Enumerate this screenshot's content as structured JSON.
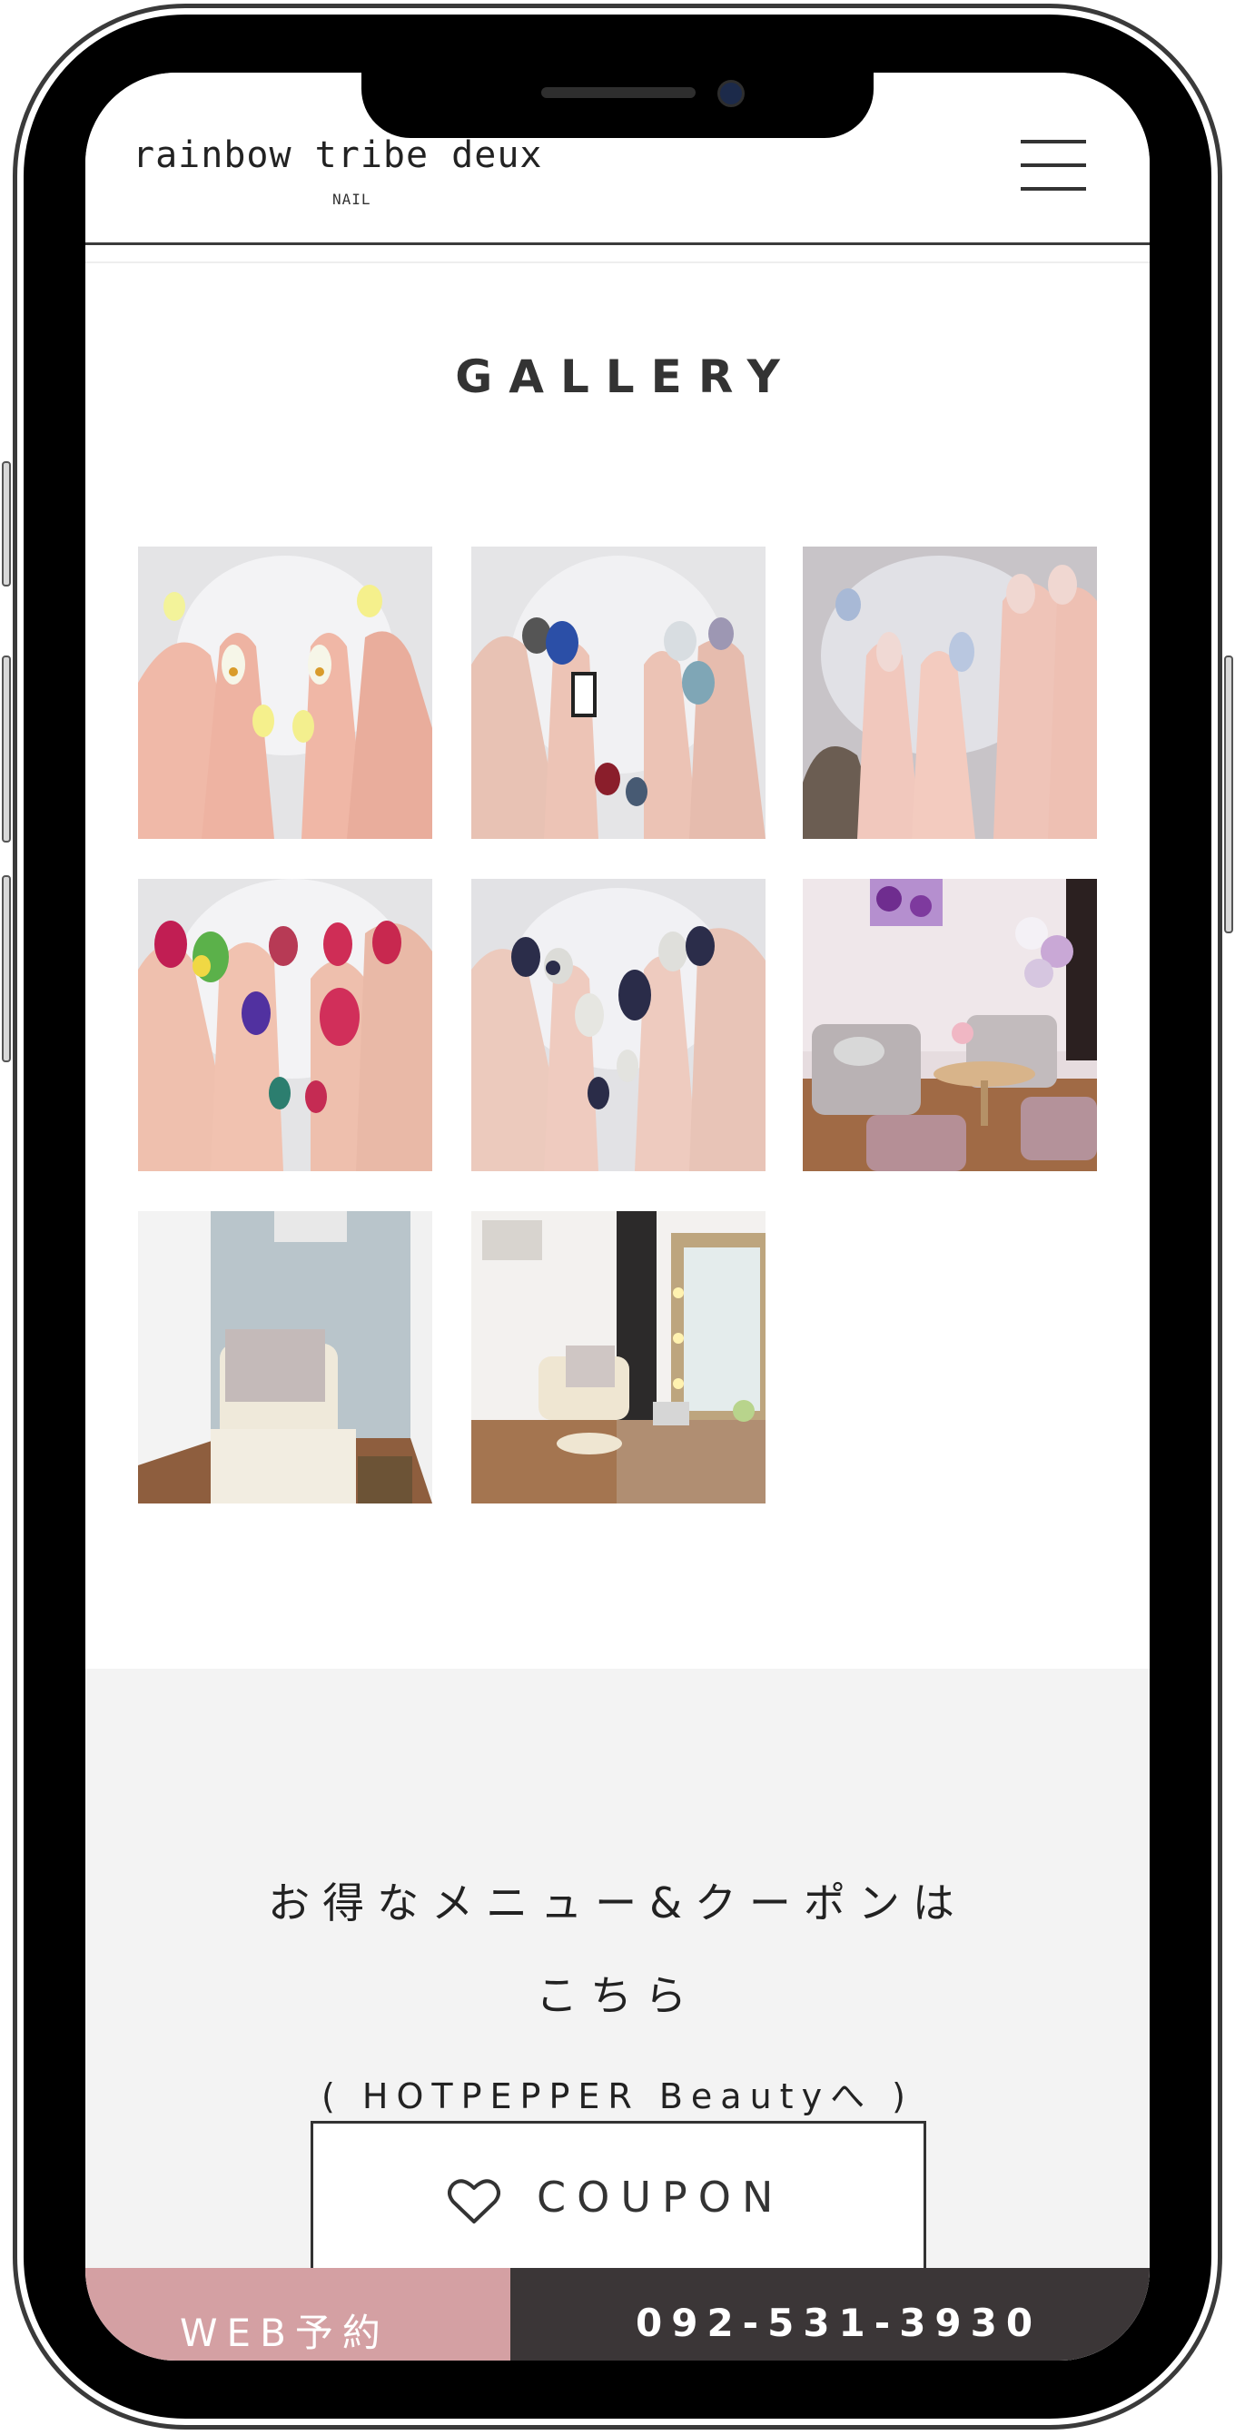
{
  "header": {
    "logo": "rainbow tribe deux",
    "logo_sub": "NAIL",
    "menu_icon": "hamburger-menu-icon"
  },
  "gallery": {
    "title": "GALLERY",
    "images": [
      {
        "name": "gallery-photo-yellow-nails",
        "subject": "yellow pastel nail art on glass"
      },
      {
        "name": "gallery-photo-blue-nails",
        "subject": "blue and navy stone nail art"
      },
      {
        "name": "gallery-photo-pink-nails",
        "subject": "nude pink nails with blue accents"
      },
      {
        "name": "gallery-photo-colorful-nails",
        "subject": "colorful jelly nails"
      },
      {
        "name": "gallery-photo-navy-nails",
        "subject": "navy and white nails"
      },
      {
        "name": "gallery-photo-salon-lounge",
        "subject": "salon lounge with chairs and balloons"
      },
      {
        "name": "gallery-photo-treatment-chair",
        "subject": "treatment chair room"
      },
      {
        "name": "gallery-photo-salon-room",
        "subject": "salon room with mirror and desk"
      }
    ]
  },
  "coupon": {
    "line1": "お得なメニュー&クーポンは",
    "line2": "こちら",
    "line3": "( HOTPEPPER Beautyへ )",
    "button_label": "COUPON",
    "button_icon": "heart-icon"
  },
  "bottom_bar": {
    "web_label": "WEB予約",
    "tel_label": "092-531-3930"
  },
  "colors": {
    "web_button": "#d4a0a3",
    "tel_button": "#3b3637",
    "coupon_bg": "#f3f3f3",
    "text": "#333333"
  }
}
